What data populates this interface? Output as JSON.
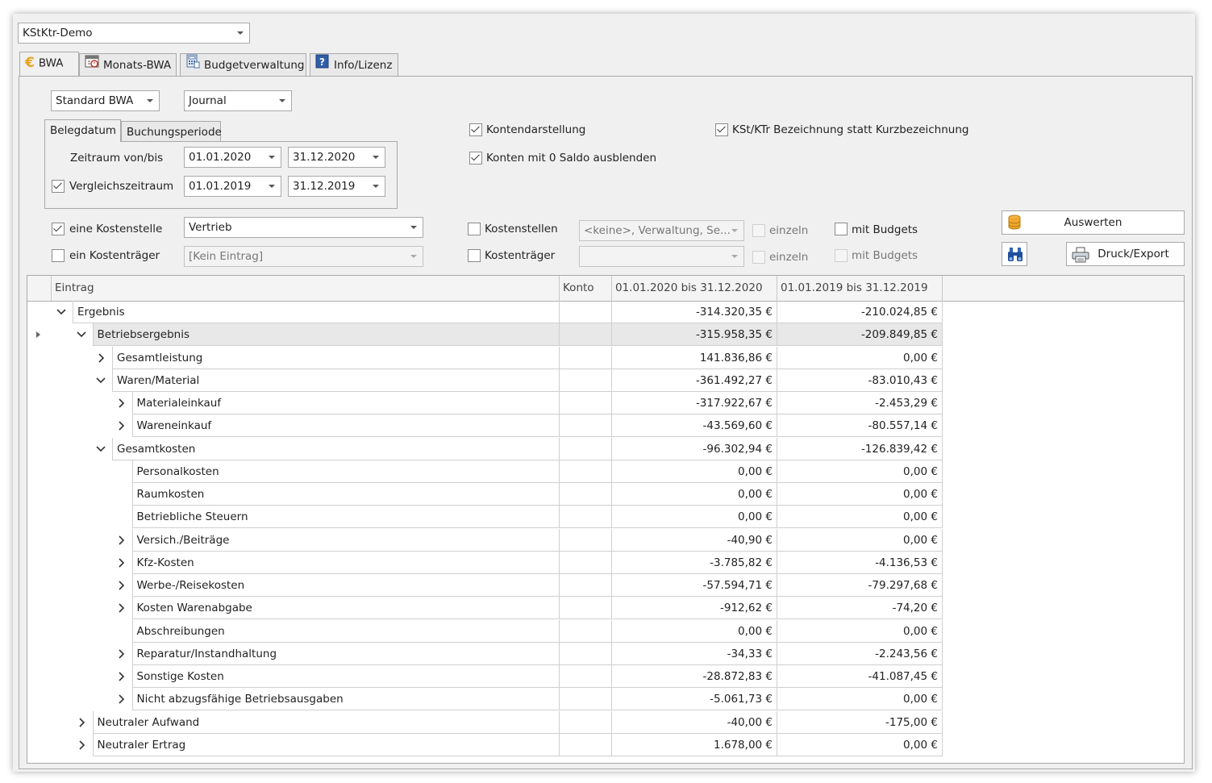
{
  "top_selector": {
    "value": "KStKtr-Demo"
  },
  "tabs": [
    {
      "label": "BWA",
      "icon": "euro-icon"
    },
    {
      "label": "Monats-BWA",
      "icon": "calendar-icon"
    },
    {
      "label": "Budgetverwaltung",
      "icon": "calculator-icon"
    },
    {
      "label": "Info/Lizenz",
      "icon": "help-icon"
    }
  ],
  "report_type": {
    "value": "Standard BWA"
  },
  "view_type": {
    "value": "Journal"
  },
  "date_tabs": [
    "Belegdatum",
    "Buchungsperiode"
  ],
  "period": {
    "label": "Zeitraum von/bis",
    "from": "01.01.2020",
    "to": "31.12.2020"
  },
  "compare_period": {
    "label": "Vergleichszeitraum",
    "from": "01.01.2019",
    "to": "31.12.2019",
    "checked": true
  },
  "options": {
    "kontendarstellung": {
      "label": "Kontendarstellung",
      "checked": true
    },
    "null_saldo": {
      "label": "Konten mit 0 Saldo ausblenden",
      "checked": true
    },
    "bezeichnung": {
      "label": "KSt/KTr Bezeichnung statt Kurzbezeichnung",
      "checked": true
    }
  },
  "filters": {
    "kostenstelle": {
      "label": "eine Kostenstelle",
      "checked": true,
      "value": "Vertrieb"
    },
    "kostentraeger": {
      "label": "ein Kostenträger",
      "checked": false,
      "value": "[Kein Eintrag]"
    },
    "kostenstellen": {
      "label": "Kostenstellen",
      "checked": false,
      "value": "<keine>, Verwaltung, Se...",
      "einzeln": "einzeln",
      "budgets": "mit Budgets"
    },
    "kostentraeger_multi": {
      "label": "Kostenträger",
      "checked": false,
      "value": "",
      "einzeln": "einzeln",
      "budgets": "mit Budgets"
    }
  },
  "buttons": {
    "evaluate": "Auswerten",
    "print": "Druck/Export"
  },
  "grid": {
    "columns": [
      "Eintrag",
      "Konto",
      "01.01.2020 bis 31.12.2020",
      "01.01.2019 bis 31.12.2019"
    ],
    "rows": [
      {
        "label": "Ergebnis",
        "level": 0,
        "state": "expanded",
        "konto": "",
        "v1": "-314.320,35 €",
        "v2": "-210.024,85 €"
      },
      {
        "label": "Betriebsergebnis",
        "level": 1,
        "state": "expanded",
        "konto": "",
        "v1": "-315.958,35 €",
        "v2": "-209.849,85 €",
        "selected": true
      },
      {
        "label": "Gesamtleistung",
        "level": 2,
        "state": "collapsed",
        "konto": "",
        "v1": "141.836,86 €",
        "v2": "0,00 €"
      },
      {
        "label": "Waren/Material",
        "level": 2,
        "state": "expanded",
        "konto": "",
        "v1": "-361.492,27 €",
        "v2": "-83.010,43 €"
      },
      {
        "label": "Materialeinkauf",
        "level": 3,
        "state": "collapsed",
        "konto": "",
        "v1": "-317.922,67 €",
        "v2": "-2.453,29 €"
      },
      {
        "label": "Wareneinkauf",
        "level": 3,
        "state": "collapsed",
        "konto": "",
        "v1": "-43.569,60 €",
        "v2": "-80.557,14 €"
      },
      {
        "label": "Gesamtkosten",
        "level": 2,
        "state": "expanded",
        "konto": "",
        "v1": "-96.302,94 €",
        "v2": "-126.839,42 €"
      },
      {
        "label": "Personalkosten",
        "level": 3,
        "state": "leaf",
        "konto": "",
        "v1": "0,00 €",
        "v2": "0,00 €"
      },
      {
        "label": "Raumkosten",
        "level": 3,
        "state": "leaf",
        "konto": "",
        "v1": "0,00 €",
        "v2": "0,00 €"
      },
      {
        "label": "Betriebliche Steuern",
        "level": 3,
        "state": "leaf",
        "konto": "",
        "v1": "0,00 €",
        "v2": "0,00 €"
      },
      {
        "label": "Versich./Beiträge",
        "level": 3,
        "state": "collapsed",
        "konto": "",
        "v1": "-40,90 €",
        "v2": "0,00 €"
      },
      {
        "label": "Kfz-Kosten",
        "level": 3,
        "state": "collapsed",
        "konto": "",
        "v1": "-3.785,82 €",
        "v2": "-4.136,53 €"
      },
      {
        "label": "Werbe-/Reisekosten",
        "level": 3,
        "state": "collapsed",
        "konto": "",
        "v1": "-57.594,71 €",
        "v2": "-79.297,68 €"
      },
      {
        "label": "Kosten Warenabgabe",
        "level": 3,
        "state": "collapsed",
        "konto": "",
        "v1": "-912,62 €",
        "v2": "-74,20 €"
      },
      {
        "label": "Abschreibungen",
        "level": 3,
        "state": "leaf",
        "konto": "",
        "v1": "0,00 €",
        "v2": "0,00 €"
      },
      {
        "label": "Reparatur/Instandhaltung",
        "level": 3,
        "state": "collapsed",
        "konto": "",
        "v1": "-34,33 €",
        "v2": "-2.243,56 €"
      },
      {
        "label": "Sonstige Kosten",
        "level": 3,
        "state": "collapsed",
        "konto": "",
        "v1": "-28.872,83 €",
        "v2": "-41.087,45 €"
      },
      {
        "label": "Nicht abzugsfähige Betriebsausgaben",
        "level": 3,
        "state": "collapsed",
        "konto": "",
        "v1": "-5.061,73 €",
        "v2": "0,00 €"
      },
      {
        "label": "Neutraler Aufwand",
        "level": 1,
        "state": "collapsed",
        "konto": "",
        "v1": "-40,00 €",
        "v2": "-175,00 €"
      },
      {
        "label": "Neutraler Ertrag",
        "level": 1,
        "state": "collapsed",
        "konto": "",
        "v1": "1.678,00 €",
        "v2": "0,00 €"
      }
    ]
  }
}
